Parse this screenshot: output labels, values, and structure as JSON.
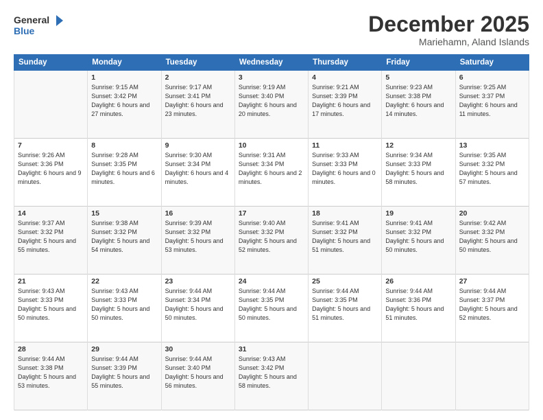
{
  "logo": {
    "line1": "General",
    "line2": "Blue",
    "arrow_color": "#2e6eb5"
  },
  "title": "December 2025",
  "subtitle": "Mariehamn, Aland Islands",
  "days_header": [
    "Sunday",
    "Monday",
    "Tuesday",
    "Wednesday",
    "Thursday",
    "Friday",
    "Saturday"
  ],
  "weeks": [
    [
      {
        "day": "",
        "sunrise": "",
        "sunset": "",
        "daylight": ""
      },
      {
        "day": "1",
        "sunrise": "Sunrise: 9:15 AM",
        "sunset": "Sunset: 3:42 PM",
        "daylight": "Daylight: 6 hours and 27 minutes."
      },
      {
        "day": "2",
        "sunrise": "Sunrise: 9:17 AM",
        "sunset": "Sunset: 3:41 PM",
        "daylight": "Daylight: 6 hours and 23 minutes."
      },
      {
        "day": "3",
        "sunrise": "Sunrise: 9:19 AM",
        "sunset": "Sunset: 3:40 PM",
        "daylight": "Daylight: 6 hours and 20 minutes."
      },
      {
        "day": "4",
        "sunrise": "Sunrise: 9:21 AM",
        "sunset": "Sunset: 3:39 PM",
        "daylight": "Daylight: 6 hours and 17 minutes."
      },
      {
        "day": "5",
        "sunrise": "Sunrise: 9:23 AM",
        "sunset": "Sunset: 3:38 PM",
        "daylight": "Daylight: 6 hours and 14 minutes."
      },
      {
        "day": "6",
        "sunrise": "Sunrise: 9:25 AM",
        "sunset": "Sunset: 3:37 PM",
        "daylight": "Daylight: 6 hours and 11 minutes."
      }
    ],
    [
      {
        "day": "7",
        "sunrise": "Sunrise: 9:26 AM",
        "sunset": "Sunset: 3:36 PM",
        "daylight": "Daylight: 6 hours and 9 minutes."
      },
      {
        "day": "8",
        "sunrise": "Sunrise: 9:28 AM",
        "sunset": "Sunset: 3:35 PM",
        "daylight": "Daylight: 6 hours and 6 minutes."
      },
      {
        "day": "9",
        "sunrise": "Sunrise: 9:30 AM",
        "sunset": "Sunset: 3:34 PM",
        "daylight": "Daylight: 6 hours and 4 minutes."
      },
      {
        "day": "10",
        "sunrise": "Sunrise: 9:31 AM",
        "sunset": "Sunset: 3:34 PM",
        "daylight": "Daylight: 6 hours and 2 minutes."
      },
      {
        "day": "11",
        "sunrise": "Sunrise: 9:33 AM",
        "sunset": "Sunset: 3:33 PM",
        "daylight": "Daylight: 6 hours and 0 minutes."
      },
      {
        "day": "12",
        "sunrise": "Sunrise: 9:34 AM",
        "sunset": "Sunset: 3:33 PM",
        "daylight": "Daylight: 5 hours and 58 minutes."
      },
      {
        "day": "13",
        "sunrise": "Sunrise: 9:35 AM",
        "sunset": "Sunset: 3:32 PM",
        "daylight": "Daylight: 5 hours and 57 minutes."
      }
    ],
    [
      {
        "day": "14",
        "sunrise": "Sunrise: 9:37 AM",
        "sunset": "Sunset: 3:32 PM",
        "daylight": "Daylight: 5 hours and 55 minutes."
      },
      {
        "day": "15",
        "sunrise": "Sunrise: 9:38 AM",
        "sunset": "Sunset: 3:32 PM",
        "daylight": "Daylight: 5 hours and 54 minutes."
      },
      {
        "day": "16",
        "sunrise": "Sunrise: 9:39 AM",
        "sunset": "Sunset: 3:32 PM",
        "daylight": "Daylight: 5 hours and 53 minutes."
      },
      {
        "day": "17",
        "sunrise": "Sunrise: 9:40 AM",
        "sunset": "Sunset: 3:32 PM",
        "daylight": "Daylight: 5 hours and 52 minutes."
      },
      {
        "day": "18",
        "sunrise": "Sunrise: 9:41 AM",
        "sunset": "Sunset: 3:32 PM",
        "daylight": "Daylight: 5 hours and 51 minutes."
      },
      {
        "day": "19",
        "sunrise": "Sunrise: 9:41 AM",
        "sunset": "Sunset: 3:32 PM",
        "daylight": "Daylight: 5 hours and 50 minutes."
      },
      {
        "day": "20",
        "sunrise": "Sunrise: 9:42 AM",
        "sunset": "Sunset: 3:32 PM",
        "daylight": "Daylight: 5 hours and 50 minutes."
      }
    ],
    [
      {
        "day": "21",
        "sunrise": "Sunrise: 9:43 AM",
        "sunset": "Sunset: 3:33 PM",
        "daylight": "Daylight: 5 hours and 50 minutes."
      },
      {
        "day": "22",
        "sunrise": "Sunrise: 9:43 AM",
        "sunset": "Sunset: 3:33 PM",
        "daylight": "Daylight: 5 hours and 50 minutes."
      },
      {
        "day": "23",
        "sunrise": "Sunrise: 9:44 AM",
        "sunset": "Sunset: 3:34 PM",
        "daylight": "Daylight: 5 hours and 50 minutes."
      },
      {
        "day": "24",
        "sunrise": "Sunrise: 9:44 AM",
        "sunset": "Sunset: 3:35 PM",
        "daylight": "Daylight: 5 hours and 50 minutes."
      },
      {
        "day": "25",
        "sunrise": "Sunrise: 9:44 AM",
        "sunset": "Sunset: 3:35 PM",
        "daylight": "Daylight: 5 hours and 51 minutes."
      },
      {
        "day": "26",
        "sunrise": "Sunrise: 9:44 AM",
        "sunset": "Sunset: 3:36 PM",
        "daylight": "Daylight: 5 hours and 51 minutes."
      },
      {
        "day": "27",
        "sunrise": "Sunrise: 9:44 AM",
        "sunset": "Sunset: 3:37 PM",
        "daylight": "Daylight: 5 hours and 52 minutes."
      }
    ],
    [
      {
        "day": "28",
        "sunrise": "Sunrise: 9:44 AM",
        "sunset": "Sunset: 3:38 PM",
        "daylight": "Daylight: 5 hours and 53 minutes."
      },
      {
        "day": "29",
        "sunrise": "Sunrise: 9:44 AM",
        "sunset": "Sunset: 3:39 PM",
        "daylight": "Daylight: 5 hours and 55 minutes."
      },
      {
        "day": "30",
        "sunrise": "Sunrise: 9:44 AM",
        "sunset": "Sunset: 3:40 PM",
        "daylight": "Daylight: 5 hours and 56 minutes."
      },
      {
        "day": "31",
        "sunrise": "Sunrise: 9:43 AM",
        "sunset": "Sunset: 3:42 PM",
        "daylight": "Daylight: 5 hours and 58 minutes."
      },
      {
        "day": "",
        "sunrise": "",
        "sunset": "",
        "daylight": ""
      },
      {
        "day": "",
        "sunrise": "",
        "sunset": "",
        "daylight": ""
      },
      {
        "day": "",
        "sunrise": "",
        "sunset": "",
        "daylight": ""
      }
    ]
  ]
}
